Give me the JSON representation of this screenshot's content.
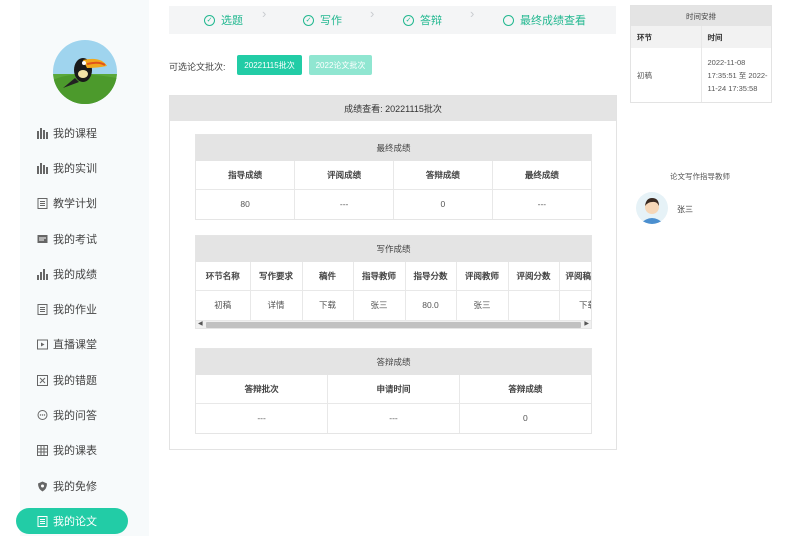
{
  "sidebar": {
    "items": [
      {
        "label": "我的课程",
        "icon": "bar-chart-icon"
      },
      {
        "label": "我的实训",
        "icon": "bar-chart-icon"
      },
      {
        "label": "教学计划",
        "icon": "document-icon"
      },
      {
        "label": "我的考试",
        "icon": "message-icon"
      },
      {
        "label": "我的成绩",
        "icon": "stats-icon"
      },
      {
        "label": "我的作业",
        "icon": "document-icon"
      },
      {
        "label": "直播课堂",
        "icon": "play-icon"
      },
      {
        "label": "我的错题",
        "icon": "error-book-icon"
      },
      {
        "label": "我的问答",
        "icon": "chat-icon"
      },
      {
        "label": "我的课表",
        "icon": "calendar-grid-icon"
      },
      {
        "label": "我的免修",
        "icon": "shield-icon"
      },
      {
        "label": "我的论文",
        "icon": "document-icon"
      }
    ],
    "active_index": 11
  },
  "steps": [
    "选题",
    "写作",
    "答辩",
    "最终成绩查看"
  ],
  "batch": {
    "label": "可选论文批次:",
    "options": [
      "20221115批次",
      "2022论文批次"
    ]
  },
  "panel": {
    "title": "成绩查看: 20221115批次",
    "final": {
      "title": "最终成绩",
      "headers": [
        "指导成绩",
        "评阅成绩",
        "答辩成绩",
        "最终成绩"
      ],
      "row": [
        "80",
        "---",
        "0",
        "---"
      ]
    },
    "writing": {
      "title": "写作成绩",
      "headers": [
        "环节名称",
        "写作要求",
        "稿件",
        "指导教师",
        "指导分数",
        "评阅教师",
        "评阅分数",
        "评阅稿件"
      ],
      "row": [
        "初稿",
        "详情",
        "下载",
        "张三",
        "80.0",
        "张三",
        "",
        "下载"
      ]
    },
    "defense": {
      "title": "答辩成绩",
      "headers": [
        "答辩批次",
        "申请时间",
        "答辩成绩"
      ],
      "row": [
        "---",
        "---",
        "0"
      ]
    }
  },
  "schedule": {
    "title": "时间安排",
    "headers": [
      "环节",
      "时间"
    ],
    "rows": [
      {
        "stage": "初稿",
        "time": "2022-11-08 17:35:51 至 2022-11-24 17:35:58"
      }
    ]
  },
  "tutor": {
    "title": "论文写作指导教师",
    "name": "张三"
  },
  "colors": {
    "accent": "#22cca6",
    "accent_light": "#90e6d1",
    "link": "#4aa0e8"
  }
}
